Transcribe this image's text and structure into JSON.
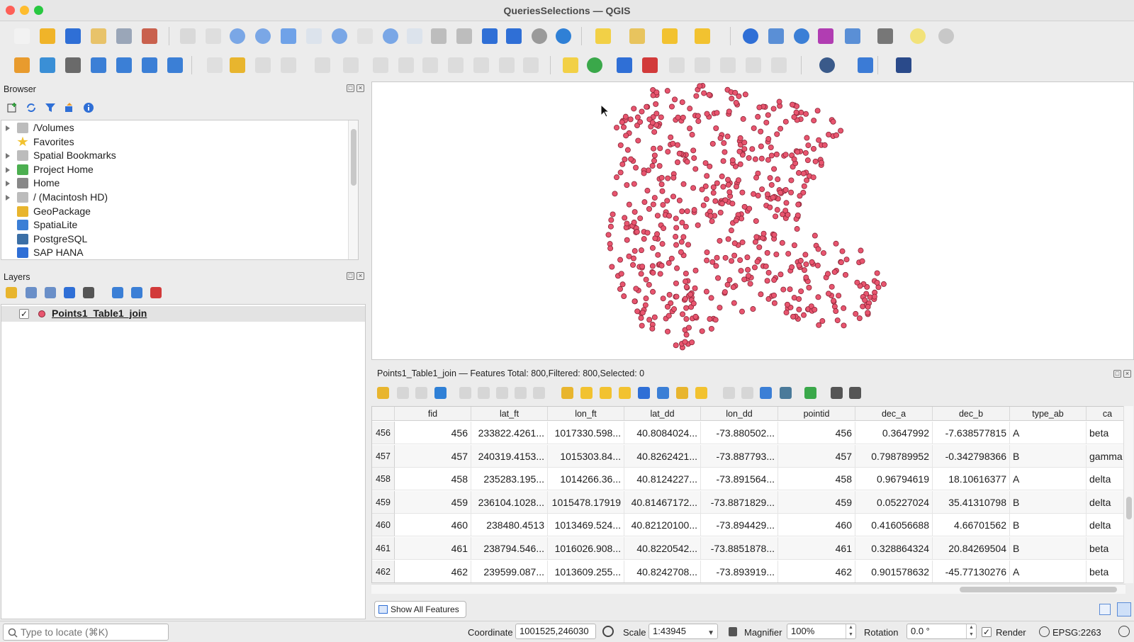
{
  "window": {
    "title": "QueriesSelections — QGIS"
  },
  "colors": {
    "point_fill": "#e8556f",
    "point_stroke": "#8a2435",
    "accent_blue": "#2f6fd6"
  },
  "browser": {
    "title": "Browser",
    "items": [
      {
        "label": "/Volumes",
        "icon": "folder-icon",
        "expandable": true
      },
      {
        "label": "Favorites",
        "icon": "star-icon",
        "expandable": false
      },
      {
        "label": "Spatial Bookmarks",
        "icon": "folder-icon",
        "expandable": true
      },
      {
        "label": "Project Home",
        "icon": "project-home-icon",
        "expandable": true
      },
      {
        "label": "Home",
        "icon": "home-icon",
        "expandable": true
      },
      {
        "label": "/ (Macintosh HD)",
        "icon": "folder-icon",
        "expandable": true
      },
      {
        "label": "GeoPackage",
        "icon": "geopackage-icon",
        "expandable": false
      },
      {
        "label": "SpatiaLite",
        "icon": "spatialite-icon",
        "expandable": false
      },
      {
        "label": "PostgreSQL",
        "icon": "postgresql-icon",
        "expandable": false
      },
      {
        "label": "SAP HANA",
        "icon": "sap-hana-icon",
        "expandable": false
      }
    ]
  },
  "layers": {
    "title": "Layers",
    "items": [
      {
        "label": "Points1_Table1_join",
        "checked": true
      }
    ]
  },
  "attribute_table": {
    "title": "Points1_Table1_join — Features Total: 800,Filtered: 800,Selected: 0",
    "columns": [
      "fid",
      "lat_ft",
      "lon_ft",
      "lat_dd",
      "lon_dd",
      "pointid",
      "dec_a",
      "dec_b",
      "type_ab",
      "ca"
    ],
    "rows": [
      {
        "row": "456",
        "cells": [
          "456",
          "233822.4261...",
          "1017330.598...",
          "40.8084024...",
          "-73.880502...",
          "456",
          "0.3647992",
          "-7.638577815",
          "A",
          "beta"
        ]
      },
      {
        "row": "457",
        "cells": [
          "457",
          "240319.4153...",
          "1015303.84...",
          "40.8262421...",
          "-73.887793...",
          "457",
          "0.798789952",
          "-0.342798366",
          "B",
          "gamma"
        ]
      },
      {
        "row": "458",
        "cells": [
          "458",
          "235283.195...",
          "1014266.36...",
          "40.8124227...",
          "-73.891564...",
          "458",
          "0.96794619",
          "18.10616377",
          "A",
          "delta"
        ]
      },
      {
        "row": "459",
        "cells": [
          "459",
          "236104.1028...",
          "1015478.17919",
          "40.81467172...",
          "-73.8871829...",
          "459",
          "0.05227024",
          "35.41310798",
          "B",
          "delta"
        ]
      },
      {
        "row": "460",
        "cells": [
          "460",
          "238480.4513",
          "1013469.524...",
          "40.82120100...",
          "-73.894429...",
          "460",
          "0.416056688",
          "4.66701562",
          "B",
          "delta"
        ]
      },
      {
        "row": "461",
        "cells": [
          "461",
          "238794.546...",
          "1016026.908...",
          "40.8220542...",
          "-73.8851878...",
          "461",
          "0.328864324",
          "20.84269504",
          "B",
          "beta"
        ]
      },
      {
        "row": "462",
        "cells": [
          "462",
          "239599.087...",
          "1013609.255...",
          "40.8242708...",
          "-73.893919...",
          "462",
          "0.901578632",
          "-45.77130276",
          "A",
          "beta"
        ]
      }
    ],
    "show_all_label": "Show All Features"
  },
  "statusbar": {
    "locate_placeholder": "Type to locate (⌘K)",
    "coordinate_label": "Coordinate",
    "coordinate_value": "1001525,246030",
    "scale_label": "Scale",
    "scale_value": "1:43945",
    "magnifier_label": "Magnifier",
    "magnifier_value": "100%",
    "rotation_label": "Rotation",
    "rotation_value": "0.0 °",
    "render_label": "Render",
    "crs_label": "EPSG:2263"
  }
}
